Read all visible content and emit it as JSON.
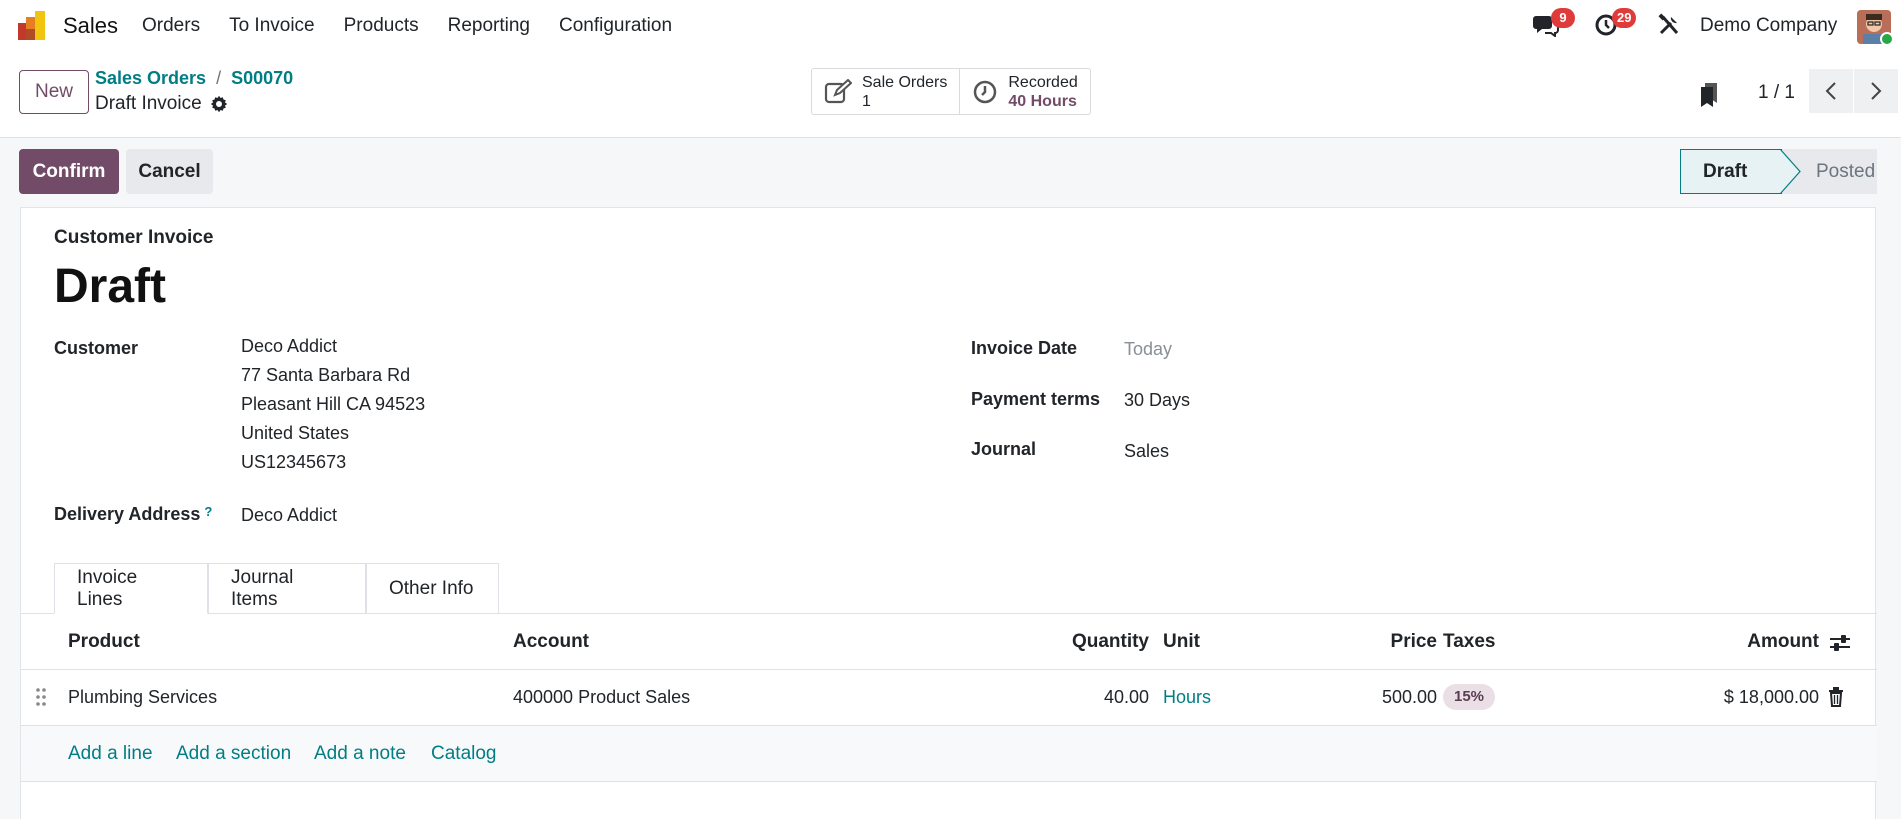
{
  "navbar": {
    "app_name": "Sales",
    "menu": [
      "Orders",
      "To Invoice",
      "Products",
      "Reporting",
      "Configuration"
    ],
    "messages_badge": "9",
    "activities_badge": "29",
    "company": "Demo Company"
  },
  "control": {
    "new_label": "New",
    "breadcrumb": [
      "Sales Orders",
      "S00070"
    ],
    "breadcrumb_sep": "/",
    "record_title": "Draft Invoice",
    "smart_buttons": [
      {
        "label": "Sale Orders",
        "value": "1"
      },
      {
        "label": "Recorded",
        "value": "40 Hours"
      }
    ],
    "pager": "1 / 1"
  },
  "status": {
    "confirm_label": "Confirm",
    "cancel_label": "Cancel",
    "stages": [
      "Draft",
      "Posted"
    ],
    "current": "Draft"
  },
  "form": {
    "doc_type": "Customer Invoice",
    "title": "Draft",
    "customer_label": "Customer",
    "customer_lines": [
      "Deco Addict",
      "77 Santa Barbara Rd",
      "Pleasant Hill CA 94523",
      "United States",
      "US12345673"
    ],
    "delivery_label": "Delivery Address",
    "delivery_help": "?",
    "delivery_value": "Deco Addict",
    "invoice_date_label": "Invoice Date",
    "invoice_date_placeholder": "Today",
    "payment_terms_label": "Payment terms",
    "payment_terms_value": "30 Days",
    "journal_label": "Journal",
    "journal_value": "Sales"
  },
  "tabs": [
    "Invoice Lines",
    "Journal Items",
    "Other Info"
  ],
  "lines": {
    "headers": {
      "product": "Product",
      "account": "Account",
      "quantity": "Quantity",
      "unit": "Unit",
      "price": "Price",
      "taxes": "Taxes",
      "amount": "Amount"
    },
    "rows": [
      {
        "product": "Plumbing Services",
        "account": "400000 Product Sales",
        "quantity": "40.00",
        "unit": "Hours",
        "price": "500.00",
        "taxes": "15%",
        "amount": "$ 18,000.00"
      }
    ],
    "add_links": [
      "Add a line",
      "Add a section",
      "Add a note",
      "Catalog"
    ]
  },
  "colors": {
    "primary": "#714b67",
    "link": "#017e84",
    "badge": "#e03b3b"
  }
}
